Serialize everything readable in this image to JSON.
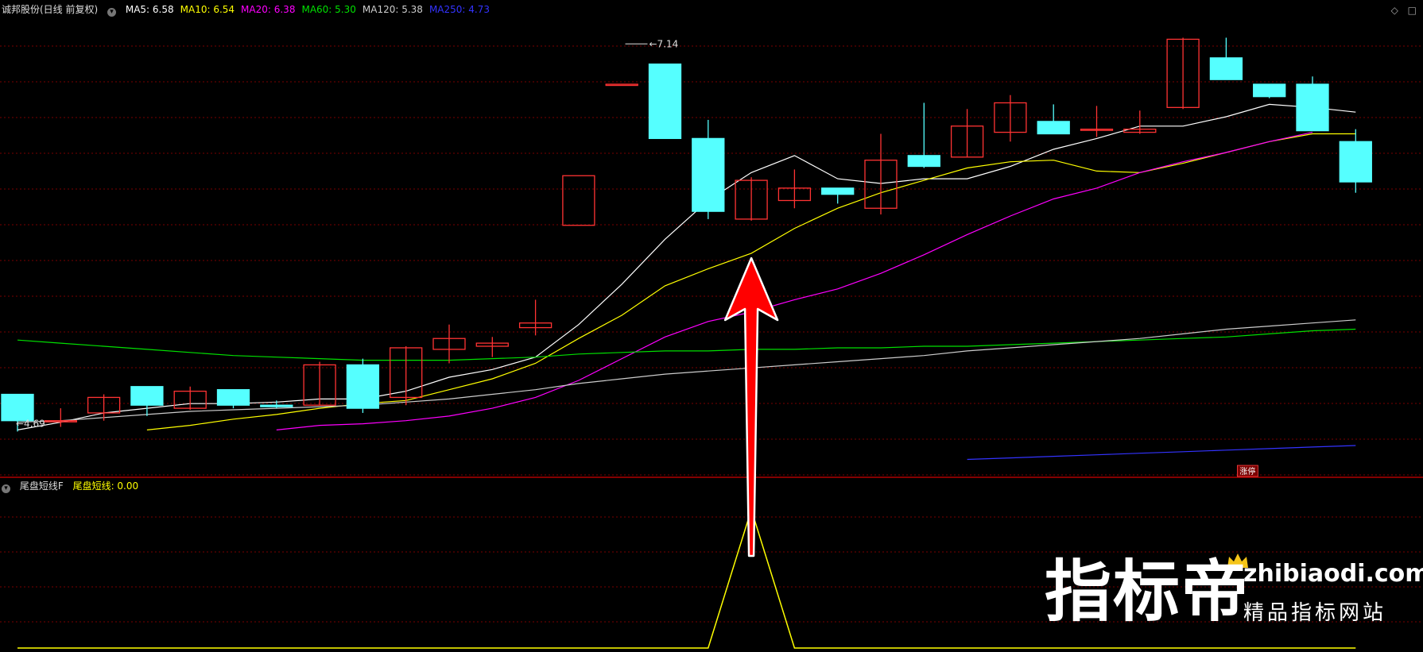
{
  "header": {
    "stock_label": "诚邦股份(日线 前复权)",
    "ma_labels": [
      {
        "text": "MA5: 6.58",
        "color": "#ffffff"
      },
      {
        "text": "MA10: 6.54",
        "color": "#ffff00"
      },
      {
        "text": "MA20: 6.38",
        "color": "#ff00ff"
      },
      {
        "text": "MA60: 5.30",
        "color": "#00e000"
      },
      {
        "text": "MA120: 5.38",
        "color": "#cccccc"
      },
      {
        "text": "MA250: 4.73",
        "color": "#3333ff"
      }
    ]
  },
  "indicator_header": {
    "name": "尾盘短线F",
    "value_label": "尾盘短线: 0.00",
    "value_color": "#ffff00"
  },
  "corner_icons": [
    "diamond-icon",
    "square-icon"
  ],
  "colors": {
    "up": "#ff3333",
    "down": "#55ffff",
    "grid": "#7a0000",
    "indicator_line": "#ffff00",
    "arrow": "#ff0000"
  },
  "chart_data": {
    "type": "candlestick",
    "ylim": [
      4.35,
      7.29
    ],
    "annotations": {
      "high_label": "7.14",
      "low_label": "4.69",
      "badge": "涨停"
    },
    "candles": [
      {
        "open": 4.88,
        "high": 4.88,
        "low": 4.64,
        "close": 4.71
      },
      {
        "open": 4.71,
        "high": 4.79,
        "low": 4.67,
        "close": 4.71
      },
      {
        "open": 4.76,
        "high": 4.88,
        "low": 4.71,
        "close": 4.86
      },
      {
        "open": 4.93,
        "high": 4.93,
        "low": 4.74,
        "close": 4.81
      },
      {
        "open": 4.79,
        "high": 4.93,
        "low": 4.78,
        "close": 4.9
      },
      {
        "open": 4.91,
        "high": 4.91,
        "low": 4.79,
        "close": 4.81
      },
      {
        "open": 4.81,
        "high": 4.84,
        "low": 4.79,
        "close": 4.8
      },
      {
        "open": 4.81,
        "high": 5.09,
        "low": 4.81,
        "close": 5.07
      },
      {
        "open": 5.07,
        "high": 5.11,
        "low": 4.76,
        "close": 4.79
      },
      {
        "open": 4.86,
        "high": 5.19,
        "low": 4.81,
        "close": 5.18
      },
      {
        "open": 5.17,
        "high": 5.33,
        "low": 5.08,
        "close": 5.24
      },
      {
        "open": 5.19,
        "high": 5.25,
        "low": 5.12,
        "close": 5.21
      },
      {
        "open": 5.31,
        "high": 5.49,
        "low": 5.26,
        "close": 5.34
      },
      {
        "open": 5.97,
        "high": 5.97,
        "low": 5.97,
        "close": 6.29
      },
      {
        "open": 6.88,
        "high": 6.88,
        "low": 6.88,
        "close": 6.88
      },
      {
        "open": 7.01,
        "high": 7.01,
        "low": 6.53,
        "close": 6.53
      },
      {
        "open": 6.53,
        "high": 6.65,
        "low": 6.01,
        "close": 6.06
      },
      {
        "open": 6.01,
        "high": 6.28,
        "low": 6.0,
        "close": 6.26
      },
      {
        "open": 6.13,
        "high": 6.33,
        "low": 6.08,
        "close": 6.21
      },
      {
        "open": 6.21,
        "high": 6.21,
        "low": 6.11,
        "close": 6.17
      },
      {
        "open": 6.08,
        "high": 6.56,
        "low": 6.04,
        "close": 6.39
      },
      {
        "open": 6.42,
        "high": 6.76,
        "low": 6.34,
        "close": 6.35
      },
      {
        "open": 6.41,
        "high": 6.72,
        "low": 6.41,
        "close": 6.61
      },
      {
        "open": 6.57,
        "high": 6.81,
        "low": 6.51,
        "close": 6.76
      },
      {
        "open": 6.64,
        "high": 6.75,
        "low": 6.56,
        "close": 6.56
      },
      {
        "open": 6.59,
        "high": 6.74,
        "low": 6.54,
        "close": 6.59
      },
      {
        "open": 6.57,
        "high": 6.71,
        "low": 6.56,
        "close": 6.59
      },
      {
        "open": 6.73,
        "high": 7.18,
        "low": 6.72,
        "close": 7.17
      },
      {
        "open": 7.05,
        "high": 7.18,
        "low": 6.91,
        "close": 6.91
      },
      {
        "open": 6.88,
        "high": 6.88,
        "low": 6.79,
        "close": 6.8
      },
      {
        "open": 6.88,
        "high": 6.93,
        "low": 6.58,
        "close": 6.58
      },
      {
        "open": 6.51,
        "high": 6.59,
        "low": 6.18,
        "close": 6.25
      }
    ],
    "series": [
      {
        "name": "MA5",
        "color": "#ffffff",
        "start": 0,
        "values": [
          4.65,
          4.7,
          4.76,
          4.79,
          4.82,
          4.82,
          4.83,
          4.85,
          4.85,
          4.9,
          4.99,
          5.04,
          5.12,
          5.33,
          5.59,
          5.88,
          6.13,
          6.31,
          6.42,
          6.27,
          6.24,
          6.27,
          6.27,
          6.35,
          6.46,
          6.53,
          6.61,
          6.61,
          6.67,
          6.75,
          6.73,
          6.7
        ]
      },
      {
        "name": "MA10",
        "color": "#ffff00",
        "start": 3,
        "values": [
          4.65,
          4.68,
          4.72,
          4.75,
          4.79,
          4.82,
          4.84,
          4.91,
          4.98,
          5.08,
          5.24,
          5.39,
          5.58,
          5.69,
          5.79,
          5.95,
          6.08,
          6.18,
          6.26,
          6.34,
          6.38,
          6.39,
          6.32,
          6.31,
          6.37,
          6.44,
          6.51,
          6.56,
          6.56
        ]
      },
      {
        "name": "MA20",
        "color": "#ff00ff",
        "start": 6,
        "values": [
          4.65,
          4.68,
          4.69,
          4.71,
          4.74,
          4.79,
          4.86,
          4.97,
          5.11,
          5.25,
          5.35,
          5.41,
          5.49,
          5.56,
          5.66,
          5.78,
          5.91,
          6.03,
          6.14,
          6.21,
          6.31,
          6.38,
          6.44,
          6.51,
          6.57
        ]
      },
      {
        "name": "MA60",
        "color": "#00e000",
        "start": 0,
        "values": [
          5.23,
          5.21,
          5.19,
          5.17,
          5.15,
          5.13,
          5.12,
          5.11,
          5.1,
          5.1,
          5.1,
          5.11,
          5.12,
          5.14,
          5.15,
          5.16,
          5.16,
          5.17,
          5.17,
          5.18,
          5.18,
          5.19,
          5.19,
          5.2,
          5.21,
          5.22,
          5.23,
          5.24,
          5.25,
          5.27,
          5.29,
          5.3
        ]
      },
      {
        "name": "MA120",
        "color": "#cccccc",
        "start": 0,
        "values": [
          4.7,
          4.71,
          4.73,
          4.75,
          4.77,
          4.78,
          4.79,
          4.8,
          4.81,
          4.83,
          4.85,
          4.88,
          4.91,
          4.95,
          4.98,
          5.01,
          5.03,
          5.05,
          5.07,
          5.09,
          5.11,
          5.13,
          5.16,
          5.18,
          5.2,
          5.22,
          5.24,
          5.27,
          5.3,
          5.32,
          5.34,
          5.36
        ]
      },
      {
        "name": "MA250",
        "color": "#3333ff",
        "start": 22,
        "values": [
          4.46,
          4.47,
          4.48,
          4.49,
          4.5,
          4.51,
          4.52,
          4.53,
          4.54,
          4.55
        ]
      }
    ],
    "indicator": {
      "name": "尾盘短线",
      "ylim": [
        0,
        1
      ],
      "values": [
        0,
        0,
        0,
        0,
        0,
        0,
        0,
        0,
        0,
        0,
        0,
        0,
        0,
        0,
        0,
        0,
        0,
        0.98,
        0,
        0,
        0,
        0,
        0,
        0,
        0,
        0,
        0,
        0,
        0,
        0,
        0,
        0
      ]
    }
  },
  "watermark": {
    "brand": "指标帝",
    "url": "zhibiaodi.com",
    "subtitle": "精品指标网站"
  }
}
